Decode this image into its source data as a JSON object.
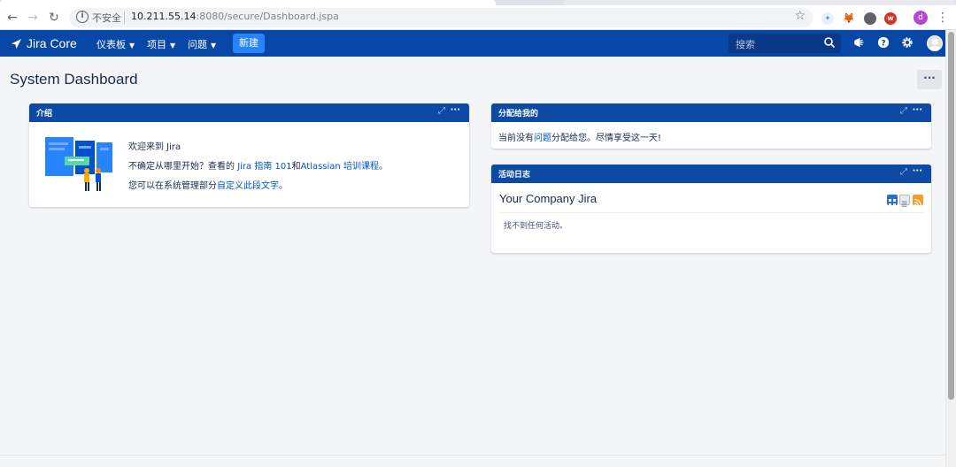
{
  "browser": {
    "insecure_label": "不安全",
    "url_host": "10.211.55.14",
    "url_rest": ":8080/secure/Dashboard.jspa",
    "profile_initial": "d"
  },
  "header": {
    "logo_text": "Jira Core",
    "menus": [
      {
        "label": "仪表板"
      },
      {
        "label": "项目"
      },
      {
        "label": "问题"
      }
    ],
    "create_label": "新建",
    "search_placeholder": "搜索"
  },
  "page": {
    "title": "System Dashboard",
    "more_label": "···"
  },
  "gadgets": {
    "intro": {
      "title": "介绍",
      "line1": "欢迎来到 Jira",
      "line2_prefix": "不确定从哪里开始？查看的 ",
      "line2_link1": "Jira 指南 101",
      "line2_mid": "和",
      "line2_link2": "Atlassian 培训课程",
      "line2_suffix": "。",
      "line3_prefix": "您可以在系统管理部分",
      "line3_link": "自定义此段文字",
      "line3_suffix": "。"
    },
    "assigned": {
      "title": "分配给我的",
      "text_prefix": "当前没有",
      "text_link": "问题",
      "text_suffix": "分配给您。尽情享受这一天!"
    },
    "activity": {
      "title": "活动日志",
      "stream_title": "Your Company Jira",
      "empty_text": "找不到任何活动。"
    }
  },
  "colors": {
    "header_bg": "#0747a6",
    "gadget_header": "#0c4aa6",
    "link": "#0052cc",
    "create_button": "#2684ff"
  }
}
